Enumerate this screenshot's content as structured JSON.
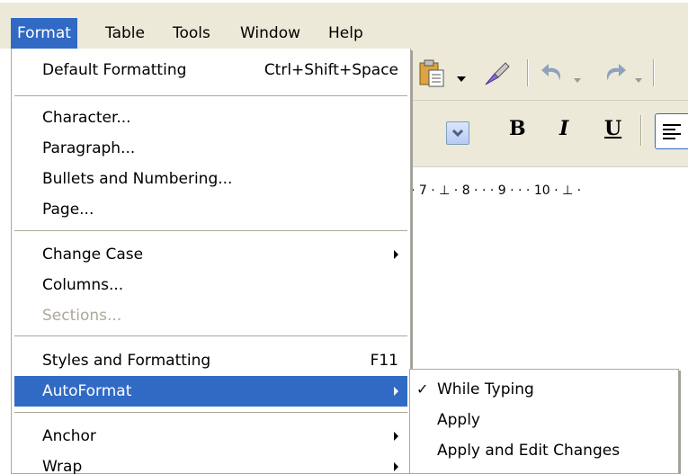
{
  "menubar": {
    "items": [
      {
        "label": "Format",
        "active": true
      },
      {
        "label": "Table"
      },
      {
        "label": "Tools"
      },
      {
        "label": "Window"
      },
      {
        "label": "Help"
      }
    ]
  },
  "toolbar": {
    "icons": [
      "paste-icon",
      "clone-formatting-icon",
      "undo-icon",
      "redo-icon",
      "bold-icon",
      "italic-icon",
      "underline-icon",
      "align-left-icon"
    ],
    "bold_label": "B",
    "italic_label": "I",
    "underline_label": "U"
  },
  "ruler": {
    "text": "· 7 · ⊥ · 8 · · · 9 · · · 10 · ⊥ ·"
  },
  "format_menu": {
    "items": [
      {
        "label": "Default Formatting",
        "shortcut": "Ctrl+Shift+Space"
      },
      {
        "label": "Character..."
      },
      {
        "label": "Paragraph..."
      },
      {
        "label": "Bullets and Numbering..."
      },
      {
        "label": "Page..."
      },
      {
        "label": "Change Case",
        "submenu": true
      },
      {
        "label": "Columns..."
      },
      {
        "label": "Sections...",
        "disabled": true
      },
      {
        "label": "Styles and Formatting",
        "shortcut": "F11"
      },
      {
        "label": "AutoFormat",
        "submenu": true,
        "highlighted": true
      },
      {
        "label": "Anchor",
        "submenu": true
      },
      {
        "label": "Wrap",
        "submenu": true
      }
    ]
  },
  "autoformat_submenu": {
    "items": [
      {
        "label": "While Typing",
        "checked": true
      },
      {
        "label": "Apply"
      },
      {
        "label": "Apply and Edit Changes"
      }
    ]
  },
  "colors": {
    "menubar_bg": "#ece9d8",
    "highlight": "#316ac5",
    "disabled_text": "#aca899"
  }
}
